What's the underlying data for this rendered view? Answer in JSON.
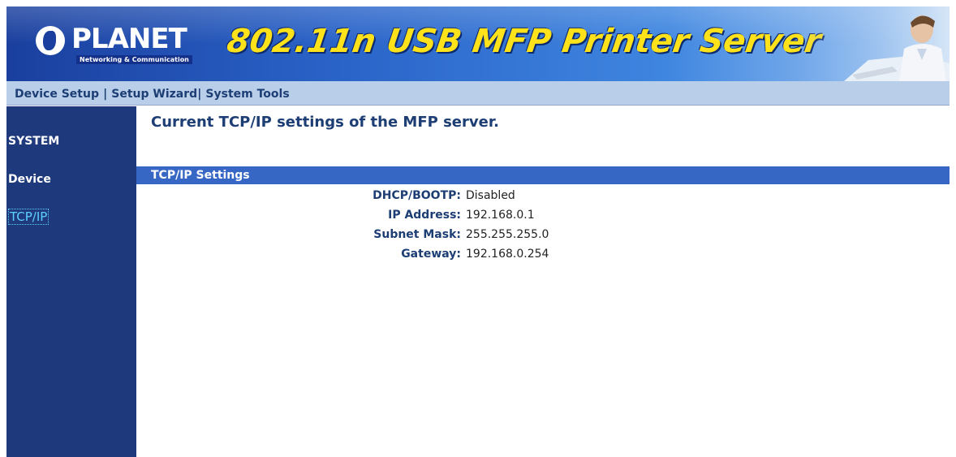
{
  "banner": {
    "logo_text": "PLANET",
    "logo_tagline": "Networking & Communication",
    "product_title": "802.11n USB MFP Printer Server"
  },
  "nav": {
    "device_setup": "Device Setup",
    "separator": "|",
    "setup_wizard": "Setup Wizard",
    "system_tools": "System Tools"
  },
  "sidebar": {
    "items": [
      {
        "label": "SYSTEM"
      },
      {
        "label": "Device"
      },
      {
        "label": "TCP/IP"
      }
    ]
  },
  "main": {
    "title": "Current TCP/IP settings of the MFP server.",
    "section_title": "TCP/IP Settings",
    "settings": [
      {
        "label": "DHCP/BOOTP:",
        "value": "Disabled"
      },
      {
        "label": "IP Address:",
        "value": "192.168.0.1"
      },
      {
        "label": "Subnet Mask:",
        "value": "255.255.255.0"
      },
      {
        "label": "Gateway:",
        "value": "192.168.0.254"
      }
    ]
  },
  "colors": {
    "sidebar_bg": "#1f3a7c",
    "nav_bg": "#b9cfe9",
    "section_bar": "#3767c4",
    "title_yellow": "#ffe21a",
    "active_link": "#5cd0ff"
  }
}
